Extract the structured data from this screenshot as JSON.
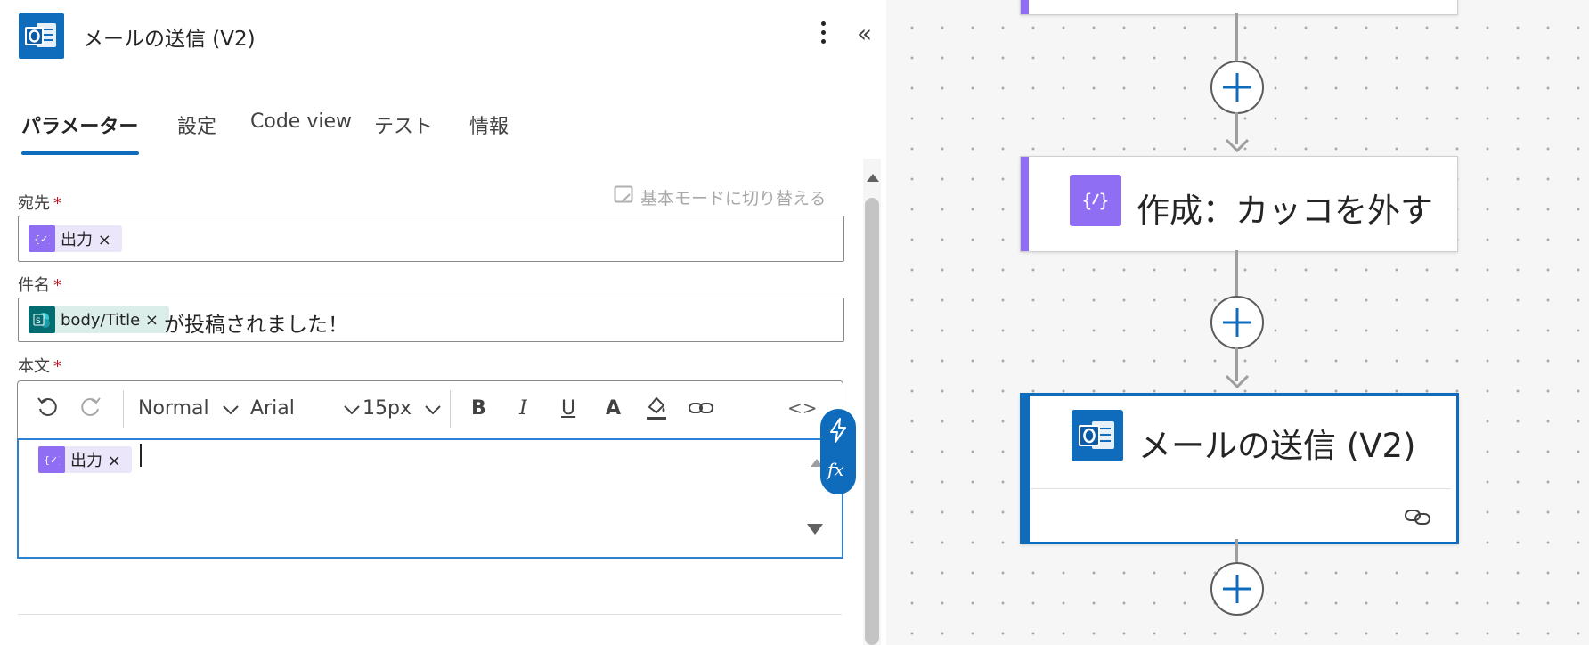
{
  "panel": {
    "title": "メールの送信 (V2)",
    "collapse_glyph": "«",
    "tabs": [
      {
        "label": "パラメーター",
        "active": true
      },
      {
        "label": "設定"
      },
      {
        "label": "Code view"
      },
      {
        "label": "テスト"
      },
      {
        "label": "情報"
      }
    ],
    "switch_mode_label": "基本モードに切り替える",
    "fields": {
      "to": {
        "label": "宛先",
        "required_mark": "*",
        "token": "出力 ×"
      },
      "subject": {
        "label": "件名",
        "required_mark": "*",
        "token": "body/Title ×",
        "text": "が投稿されました！"
      },
      "body": {
        "label": "本文",
        "required_mark": "*",
        "token": "出力 ×"
      }
    },
    "toolbar": {
      "format": "Normal",
      "font": "Arial",
      "size": "15px",
      "bold": "B",
      "italic": "I",
      "underline": "U",
      "font_color": "A",
      "code": "<>"
    },
    "fx_label": "fx"
  },
  "canvas": {
    "cards": [
      {
        "title": "作成：カッコを外す",
        "icon": "compose-icon",
        "accent": "#8f6ef4"
      },
      {
        "title": "メールの送信 (V2)",
        "icon": "outlook-icon",
        "accent": "#0f6cbd"
      }
    ]
  },
  "colors": {
    "brand_blue": "#0f6cbd",
    "expression_purple": "#8f6ef4",
    "sharepoint_teal": "#036c70",
    "required_red": "#c50f1f"
  }
}
